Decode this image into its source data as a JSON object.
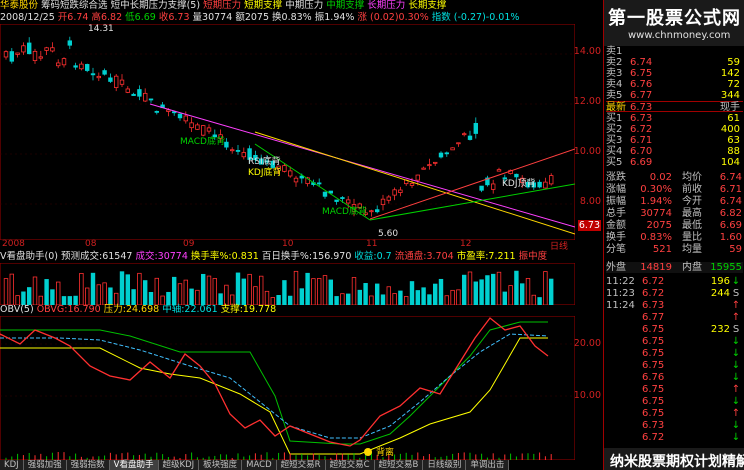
{
  "header": {
    "stock_name": "华泰股份",
    "indicator_name": "筹码短跌综合选",
    "line_title": "短中长期压力支撑(5)",
    "items": [
      "短期压力",
      "短期支撑",
      "中期压力",
      "中期支撑",
      "长期压力",
      "长期支撑"
    ]
  },
  "info_bar": {
    "date": "2008/12/25",
    "open": "开6.74",
    "high": "高6.82",
    "low": "低6.69",
    "close": "收6.73",
    "vol": "量30774",
    "amount": "额2075",
    "turnover": "换0.83%",
    "amplitude": "振1.94%",
    "change": "涨 (0.02)0.30%",
    "index": "指数 (-0.27)-0.01%"
  },
  "main_chart": {
    "price_ticks": [
      "14.00",
      "12.00",
      "10.00",
      "8.00",
      "6.73"
    ],
    "top_label": "14.31",
    "bottom_label": "5.60",
    "annotations": [
      "MACD底背",
      "RSI底背",
      "KDJ底背",
      "MACD底背",
      "KDJ顶背"
    ],
    "dates": [
      "2008",
      "08",
      "09",
      "10",
      "11",
      "12",
      "日线"
    ]
  },
  "volume_panel": {
    "title": "V看盘助手(0)",
    "pred": "预测成交:61547",
    "vol": "成交:30774",
    "turnover": "换手率%:0.831",
    "hundred_day": "百日换手%:156.970",
    "pct": "收益:0.7",
    "float": "流通盘:3.704",
    "pe": "市盈率:7.211",
    "vol_label": "振中度"
  },
  "obv_panel": {
    "title": "OBV(5)",
    "obvg": "OBVG:16.790",
    "pressure": "压力:24.698",
    "middle": "中轴:22.061",
    "support": "支撑:19.778",
    "axis": [
      "20.00",
      "10.00"
    ],
    "marker": "背离"
  },
  "tabs": [
    "KDJ",
    "强弱加强",
    "强弱指数",
    "V看盘助手",
    "超级KDJ",
    "板块强度",
    "MACD",
    "超短交易R",
    "超短交易C",
    "超短交易B",
    "日线级别",
    "单调出击"
  ],
  "watermark": {
    "title": "第一股票公式网",
    "url": "www.chnmoney.com",
    "footer": "纳米股票期权计划精解"
  },
  "order_book": {
    "sells": [
      {
        "label": "卖5",
        "price": "6.77",
        "vol": "344"
      },
      {
        "label": "卖4",
        "price": "6.76",
        "vol": "72"
      },
      {
        "label": "卖3",
        "price": "6.75",
        "vol": "142"
      },
      {
        "label": "卖2",
        "price": "6.74",
        "vol": "59"
      },
      {
        "label": "卖1",
        "price": "",
        "vol": ""
      }
    ],
    "latest_label": "最新",
    "latest_price": "6.73",
    "latest_extra": "现手",
    "buys": [
      {
        "label": "买1",
        "price": "6.73",
        "vol": "61"
      },
      {
        "label": "买2",
        "price": "6.72",
        "vol": "400"
      },
      {
        "label": "买3",
        "price": "6.71",
        "vol": "63"
      },
      {
        "label": "买4",
        "price": "6.70",
        "vol": "88"
      },
      {
        "label": "买5",
        "price": "6.69",
        "vol": "104"
      }
    ]
  },
  "stats": [
    {
      "l1": "涨跌",
      "v1": "0.02",
      "l2": "均价",
      "v2": "6.74"
    },
    {
      "l1": "涨幅",
      "v1": "0.30%",
      "l2": "前收",
      "v2": "6.71"
    },
    {
      "l1": "振幅",
      "v1": "1.94%",
      "l2": "今开",
      "v2": "6.74"
    },
    {
      "l1": "总手",
      "v1": "30774",
      "l2": "最高",
      "v2": "6.82"
    },
    {
      "l1": "金额",
      "v1": "2075",
      "l2": "最低",
      "v2": "6.69"
    },
    {
      "l1": "换手",
      "v1": "0.83%",
      "l2": "量比",
      "v2": "1.60"
    },
    {
      "l1": "分笔",
      "v1": "521",
      "l2": "均量",
      "v2": "59"
    }
  ],
  "outer_inner": {
    "outer_label": "外盘",
    "outer": "14819",
    "inner_label": "内盘",
    "inner": "15955"
  },
  "ticks": [
    {
      "time": "11:22",
      "price": "6.72",
      "vol": "196",
      "dir": "↓"
    },
    {
      "time": "11:23",
      "price": "6.72",
      "vol": "244",
      "dir": "S"
    },
    {
      "time": "11:24",
      "price": "6.73",
      "vol": "",
      "dir": "↑"
    },
    {
      "time": "",
      "price": "6.77",
      "vol": "",
      "dir": "↑"
    },
    {
      "time": "",
      "price": "6.75",
      "vol": "232",
      "dir": "S"
    },
    {
      "time": "",
      "price": "6.75",
      "vol": "",
      "dir": "↓"
    },
    {
      "time": "",
      "price": "6.75",
      "vol": "",
      "dir": "↓"
    },
    {
      "time": "",
      "price": "6.75",
      "vol": "",
      "dir": "↓"
    },
    {
      "time": "",
      "price": "6.76",
      "vol": "",
      "dir": "↓"
    },
    {
      "time": "",
      "price": "6.75",
      "vol": "",
      "dir": "↑"
    },
    {
      "time": "",
      "price": "6.75",
      "vol": "",
      "dir": "↓"
    },
    {
      "time": "",
      "price": "6.75",
      "vol": "",
      "dir": "↑"
    },
    {
      "time": "",
      "price": "6.73",
      "vol": "",
      "dir": "↓"
    },
    {
      "time": "",
      "price": "6.72",
      "vol": "",
      "dir": "↓"
    }
  ]
}
